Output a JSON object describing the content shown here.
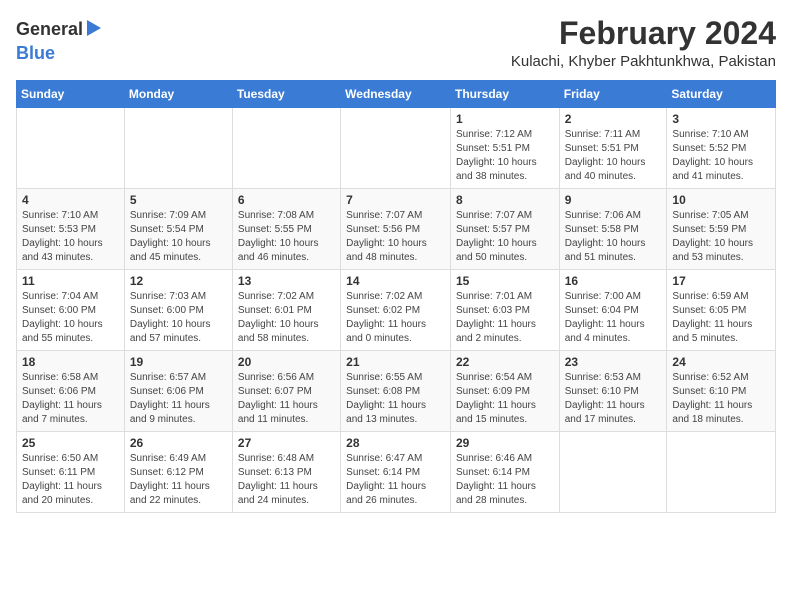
{
  "logo": {
    "general": "General",
    "blue": "Blue"
  },
  "title": {
    "month": "February 2024",
    "location": "Kulachi, Khyber Pakhtunkhwa, Pakistan"
  },
  "weekdays": [
    "Sunday",
    "Monday",
    "Tuesday",
    "Wednesday",
    "Thursday",
    "Friday",
    "Saturday"
  ],
  "weeks": [
    [
      {
        "day": "",
        "info": ""
      },
      {
        "day": "",
        "info": ""
      },
      {
        "day": "",
        "info": ""
      },
      {
        "day": "",
        "info": ""
      },
      {
        "day": "1",
        "info": "Sunrise: 7:12 AM\nSunset: 5:51 PM\nDaylight: 10 hours\nand 38 minutes."
      },
      {
        "day": "2",
        "info": "Sunrise: 7:11 AM\nSunset: 5:51 PM\nDaylight: 10 hours\nand 40 minutes."
      },
      {
        "day": "3",
        "info": "Sunrise: 7:10 AM\nSunset: 5:52 PM\nDaylight: 10 hours\nand 41 minutes."
      }
    ],
    [
      {
        "day": "4",
        "info": "Sunrise: 7:10 AM\nSunset: 5:53 PM\nDaylight: 10 hours\nand 43 minutes."
      },
      {
        "day": "5",
        "info": "Sunrise: 7:09 AM\nSunset: 5:54 PM\nDaylight: 10 hours\nand 45 minutes."
      },
      {
        "day": "6",
        "info": "Sunrise: 7:08 AM\nSunset: 5:55 PM\nDaylight: 10 hours\nand 46 minutes."
      },
      {
        "day": "7",
        "info": "Sunrise: 7:07 AM\nSunset: 5:56 PM\nDaylight: 10 hours\nand 48 minutes."
      },
      {
        "day": "8",
        "info": "Sunrise: 7:07 AM\nSunset: 5:57 PM\nDaylight: 10 hours\nand 50 minutes."
      },
      {
        "day": "9",
        "info": "Sunrise: 7:06 AM\nSunset: 5:58 PM\nDaylight: 10 hours\nand 51 minutes."
      },
      {
        "day": "10",
        "info": "Sunrise: 7:05 AM\nSunset: 5:59 PM\nDaylight: 10 hours\nand 53 minutes."
      }
    ],
    [
      {
        "day": "11",
        "info": "Sunrise: 7:04 AM\nSunset: 6:00 PM\nDaylight: 10 hours\nand 55 minutes."
      },
      {
        "day": "12",
        "info": "Sunrise: 7:03 AM\nSunset: 6:00 PM\nDaylight: 10 hours\nand 57 minutes."
      },
      {
        "day": "13",
        "info": "Sunrise: 7:02 AM\nSunset: 6:01 PM\nDaylight: 10 hours\nand 58 minutes."
      },
      {
        "day": "14",
        "info": "Sunrise: 7:02 AM\nSunset: 6:02 PM\nDaylight: 11 hours\nand 0 minutes."
      },
      {
        "day": "15",
        "info": "Sunrise: 7:01 AM\nSunset: 6:03 PM\nDaylight: 11 hours\nand 2 minutes."
      },
      {
        "day": "16",
        "info": "Sunrise: 7:00 AM\nSunset: 6:04 PM\nDaylight: 11 hours\nand 4 minutes."
      },
      {
        "day": "17",
        "info": "Sunrise: 6:59 AM\nSunset: 6:05 PM\nDaylight: 11 hours\nand 5 minutes."
      }
    ],
    [
      {
        "day": "18",
        "info": "Sunrise: 6:58 AM\nSunset: 6:06 PM\nDaylight: 11 hours\nand 7 minutes."
      },
      {
        "day": "19",
        "info": "Sunrise: 6:57 AM\nSunset: 6:06 PM\nDaylight: 11 hours\nand 9 minutes."
      },
      {
        "day": "20",
        "info": "Sunrise: 6:56 AM\nSunset: 6:07 PM\nDaylight: 11 hours\nand 11 minutes."
      },
      {
        "day": "21",
        "info": "Sunrise: 6:55 AM\nSunset: 6:08 PM\nDaylight: 11 hours\nand 13 minutes."
      },
      {
        "day": "22",
        "info": "Sunrise: 6:54 AM\nSunset: 6:09 PM\nDaylight: 11 hours\nand 15 minutes."
      },
      {
        "day": "23",
        "info": "Sunrise: 6:53 AM\nSunset: 6:10 PM\nDaylight: 11 hours\nand 17 minutes."
      },
      {
        "day": "24",
        "info": "Sunrise: 6:52 AM\nSunset: 6:10 PM\nDaylight: 11 hours\nand 18 minutes."
      }
    ],
    [
      {
        "day": "25",
        "info": "Sunrise: 6:50 AM\nSunset: 6:11 PM\nDaylight: 11 hours\nand 20 minutes."
      },
      {
        "day": "26",
        "info": "Sunrise: 6:49 AM\nSunset: 6:12 PM\nDaylight: 11 hours\nand 22 minutes."
      },
      {
        "day": "27",
        "info": "Sunrise: 6:48 AM\nSunset: 6:13 PM\nDaylight: 11 hours\nand 24 minutes."
      },
      {
        "day": "28",
        "info": "Sunrise: 6:47 AM\nSunset: 6:14 PM\nDaylight: 11 hours\nand 26 minutes."
      },
      {
        "day": "29",
        "info": "Sunrise: 6:46 AM\nSunset: 6:14 PM\nDaylight: 11 hours\nand 28 minutes."
      },
      {
        "day": "",
        "info": ""
      },
      {
        "day": "",
        "info": ""
      }
    ]
  ]
}
